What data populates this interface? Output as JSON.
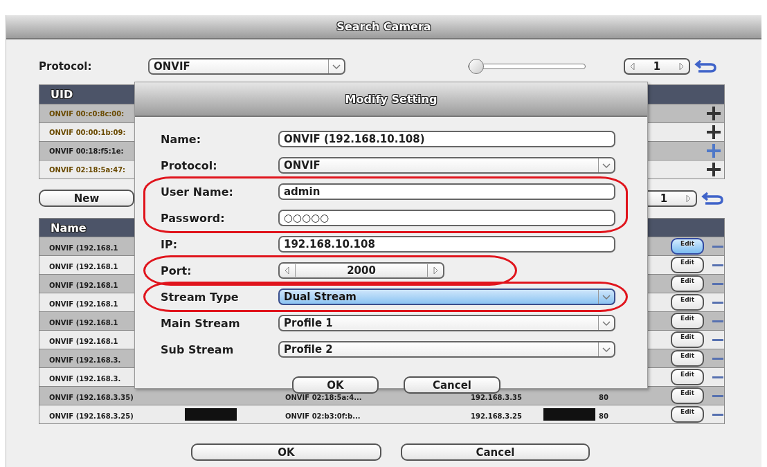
{
  "window": {
    "title": "Search Camera"
  },
  "protocol": {
    "label": "Protocol:",
    "value": "ONVIF"
  },
  "slider": {
    "level": 0.04
  },
  "pager_top": {
    "page": "1"
  },
  "uid_table": {
    "header": "UID",
    "rows": [
      {
        "uid": "ONVIF 00:c0:8c:00:",
        "highlighted": true,
        "add_selected": false
      },
      {
        "uid": "ONVIF 00:00:1b:09:",
        "highlighted": true,
        "add_selected": false
      },
      {
        "uid": "ONVIF 00:18:f5:1e:",
        "highlighted": false,
        "add_selected": true
      },
      {
        "uid": "ONVIF 02:18:5a:47:",
        "highlighted": true,
        "add_selected": false
      }
    ]
  },
  "new_button": "New",
  "pager_bottom": {
    "page": "1"
  },
  "name_table": {
    "header": "Name",
    "rows": [
      {
        "name": "ONVIF (192.168.1",
        "edit": "Edit",
        "selected": true
      },
      {
        "name": "ONVIF (192.168.1",
        "edit": "Edit",
        "selected": false
      },
      {
        "name": "ONVIF (192.168.1",
        "edit": "Edit",
        "selected": false
      },
      {
        "name": "ONVIF (192.168.1",
        "edit": "Edit",
        "selected": false
      },
      {
        "name": "ONVIF (192.168.1",
        "edit": "Edit",
        "selected": false
      },
      {
        "name": "ONVIF (192.168.1",
        "edit": "Edit",
        "selected": false
      },
      {
        "name": "ONVIF (192.168.3.",
        "edit": "Edit",
        "selected": false
      },
      {
        "name": "ONVIF (192.168.3.",
        "edit": "Edit",
        "selected": false
      },
      {
        "name": "ONVIF (192.168.3.35)",
        "uid": "ONVIF 02:18:5a:4...",
        "ip": "192.168.3.35",
        "port": "80",
        "masked": false,
        "edit": "Edit",
        "selected": false
      },
      {
        "name": "ONVIF (192.168.3.25)",
        "uid": "ONVIF 02:b3:0f:b...",
        "ip": "192.168.3.25",
        "port": "80",
        "masked": true,
        "edit": "Edit",
        "selected": false
      }
    ]
  },
  "buttons": [
    "OK",
    "Cancel"
  ],
  "dialog": {
    "title": "Modify Setting",
    "groups": [
      {
        "circled": false,
        "fields": [
          {
            "label": "Name:",
            "kind": "text",
            "value": "ONVIF (192.168.10.108)",
            "focused": false
          },
          {
            "label": "Protocol:",
            "kind": "dropdown",
            "value": "ONVIF",
            "focused": false
          }
        ]
      },
      {
        "circled": true,
        "fields": [
          {
            "label": "User Name:",
            "kind": "text",
            "value": "admin",
            "focused": false
          },
          {
            "label": "Password:",
            "kind": "text",
            "value": "○○○○○",
            "focused": false
          }
        ]
      },
      {
        "circled": false,
        "fields": [
          {
            "label": "IP:",
            "kind": "text",
            "value": "192.168.10.108",
            "focused": false
          }
        ]
      },
      {
        "circled": true,
        "fields": [
          {
            "label": "Port:",
            "kind": "spinner",
            "value": "2000",
            "focused": false
          }
        ]
      },
      {
        "circled": true,
        "fields": [
          {
            "label": "Stream Type",
            "kind": "dropdown",
            "value": "Dual Stream",
            "focused": true
          }
        ]
      },
      {
        "circled": false,
        "fields": [
          {
            "label": "Main Stream",
            "kind": "dropdown",
            "value": "Profile 1",
            "focused": false
          },
          {
            "label": "Sub Stream",
            "kind": "dropdown",
            "value": "Profile 2",
            "focused": false
          }
        ]
      }
    ],
    "buttons": [
      "OK",
      "Cancel"
    ]
  }
}
